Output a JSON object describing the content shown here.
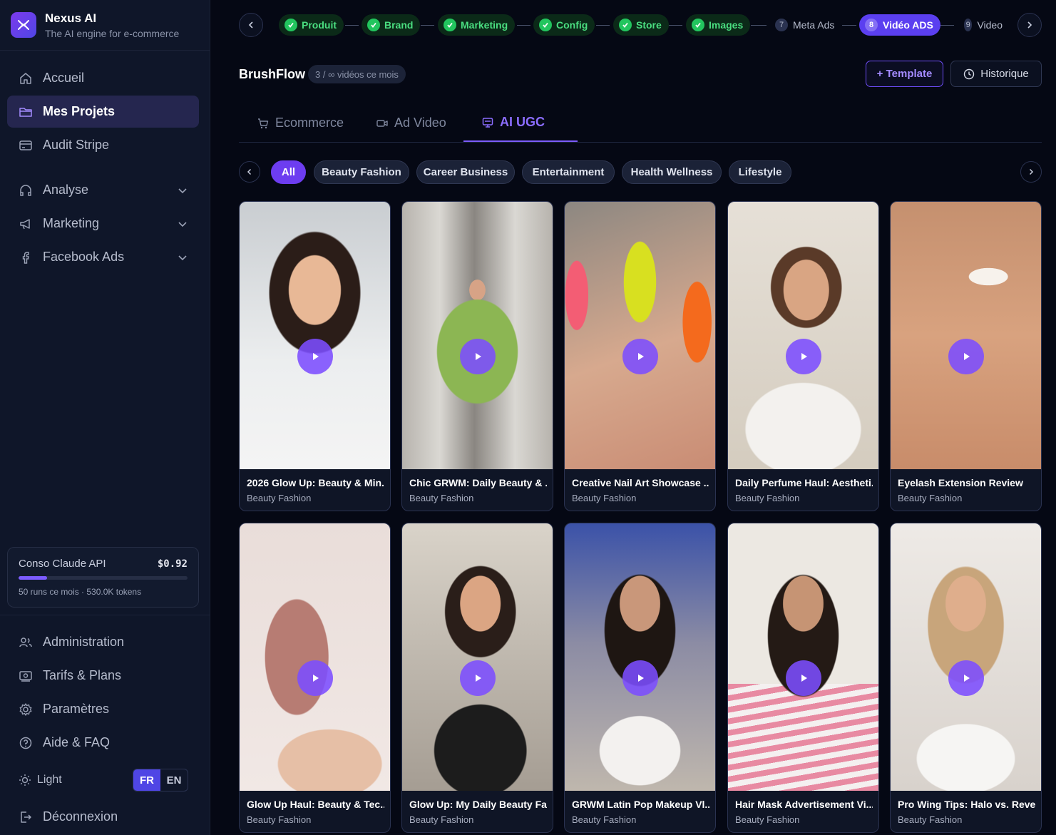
{
  "brand": {
    "name": "Nexus AI",
    "tagline": "The AI engine for e-commerce"
  },
  "nav": {
    "main": [
      {
        "label": "Accueil",
        "icon": "home-icon"
      },
      {
        "label": "Mes Projets",
        "icon": "folder-icon",
        "active": true
      },
      {
        "label": "Audit Stripe",
        "icon": "card-icon"
      }
    ],
    "groups": [
      {
        "label": "Analyse",
        "icon": "headset-icon"
      },
      {
        "label": "Marketing",
        "icon": "megaphone-icon"
      },
      {
        "label": "Facebook Ads",
        "icon": "facebook-icon"
      }
    ],
    "footer": [
      {
        "label": "Administration",
        "icon": "users-icon"
      },
      {
        "label": "Tarifs & Plans",
        "icon": "pricing-icon"
      },
      {
        "label": "Paramètres",
        "icon": "settings-icon"
      },
      {
        "label": "Aide & FAQ",
        "icon": "help-icon"
      }
    ],
    "theme_label": "Light",
    "lang_fr": "FR",
    "lang_en": "EN",
    "logout": "Déconnexion"
  },
  "usage": {
    "title": "Conso Claude API",
    "cost": "$0.92",
    "progress": 0.17,
    "sub": "50 runs ce mois · 530.0K tokens"
  },
  "stepper": {
    "steps": [
      {
        "label": "Produit",
        "state": "done"
      },
      {
        "label": "Brand",
        "state": "done"
      },
      {
        "label": "Marketing",
        "state": "done"
      },
      {
        "label": "Config",
        "state": "done"
      },
      {
        "label": "Store",
        "state": "done"
      },
      {
        "label": "Images",
        "state": "done"
      },
      {
        "num": "7",
        "label": "Meta Ads",
        "state": "todo"
      },
      {
        "num": "8",
        "label": "Vidéo ADS",
        "state": "current"
      },
      {
        "num": "9",
        "label": "Video",
        "state": "todo"
      }
    ]
  },
  "header": {
    "project": "BrushFlow",
    "quota": "3 / ∞ vidéos ce mois",
    "template_btn": "+ Template",
    "history_btn": "Historique"
  },
  "tabs": [
    {
      "label": "Ecommerce",
      "icon": "cart-icon"
    },
    {
      "label": "Ad Video",
      "icon": "video-icon"
    },
    {
      "label": "AI UGC",
      "icon": "monitor-icon",
      "active": true
    }
  ],
  "chips": [
    "All",
    "Beauty Fashion",
    "Career Business",
    "Entertainment",
    "Health Wellness",
    "Lifestyle"
  ],
  "videos": [
    {
      "title": "2026 Glow Up: Beauty & Min...",
      "category": "Beauty Fashion"
    },
    {
      "title": "Chic GRWM: Daily Beauty & ...",
      "category": "Beauty Fashion"
    },
    {
      "title": "Creative Nail Art Showcase ...",
      "category": "Beauty Fashion"
    },
    {
      "title": "Daily Perfume Haul: Aestheti...",
      "category": "Beauty Fashion"
    },
    {
      "title": "Eyelash Extension Review",
      "category": "Beauty Fashion"
    },
    {
      "title": "Glow Up Haul: Beauty & Tec...",
      "category": "Beauty Fashion"
    },
    {
      "title": "Glow Up: My Daily Beauty Fa...",
      "category": "Beauty Fashion"
    },
    {
      "title": "GRWM Latin Pop Makeup Vl...",
      "category": "Beauty Fashion"
    },
    {
      "title": "Hair Mask Advertisement Vi...",
      "category": "Beauty Fashion"
    },
    {
      "title": "Pro Wing Tips: Halo vs. Reve...",
      "category": "Beauty Fashion"
    }
  ],
  "colors": {
    "accent": "#7c5cff",
    "success": "#22c55e",
    "background": "#050814",
    "sidebar": "#0f1629"
  }
}
